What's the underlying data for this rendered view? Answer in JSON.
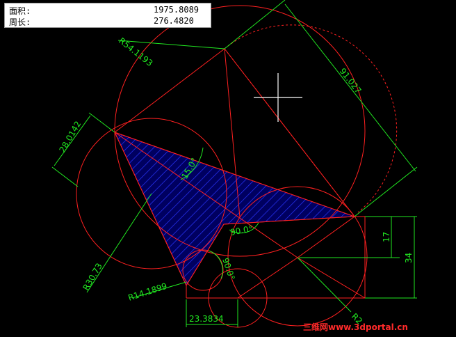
{
  "info_panel": {
    "area_label": "面积:",
    "area_value": "1975.8089",
    "perimeter_label": "周长:",
    "perimeter_value": "276.4820"
  },
  "dimensions": {
    "r54": "R54.1193",
    "d91": "91.027",
    "d28": "28.0142",
    "a15": "15.0°",
    "a90_center": "90.0°",
    "a90_lower": "90.0°",
    "r30": "R30.73",
    "r14": "R14.1899",
    "d23": "23.3834",
    "d17": "17",
    "d34": "34",
    "r_partial": "R2"
  },
  "watermark": "三维网www.3dportal.cn",
  "colors": {
    "background": "#000000",
    "geometry": "#ff2020",
    "dimension": "#21e821",
    "hatch": "#2a35ff",
    "fill": "#000060",
    "cursor": "#ffffff"
  }
}
